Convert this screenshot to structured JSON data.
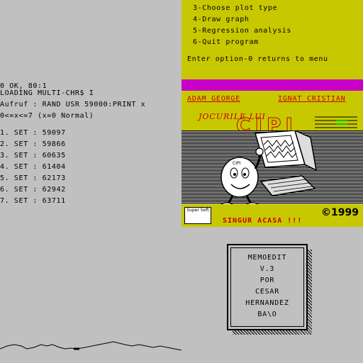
{
  "menu": {
    "items": [
      "3-Choose plot type",
      "4-Draw graph",
      "5-Regression analysis",
      "6-Quit program"
    ],
    "prompt": "Enter option-0 returns to menu"
  },
  "console": {
    "status": "0 OK, 80:1",
    "loading": "LOADING MULTI-CHR$ I",
    "call": "Aufruf : RAND USR 59000:PRINT x",
    "range": "0<=x<=7 (x=0 Normal)",
    "sets": [
      "1. SET : 59097",
      "2. SET : 59866",
      "3. SET : 60635",
      "4. SET : 61404",
      "5. SET : 62173",
      "6. SET : 62942",
      "7. SET : 63711"
    ]
  },
  "game": {
    "author1": "ADAM GEORGE",
    "author2": "IGNAT CRISTIAN",
    "subtitle": "JOCURILE LUI",
    "title": "CIPI",
    "character_label": "CIPI",
    "publisher": "Super Soft",
    "tagline": "SINGUR ACASA !!!",
    "year": "©1999"
  },
  "memo": {
    "lines": [
      "MEMOEDIT",
      "V.3",
      "POR",
      "CESAR",
      "HERNANDEZ",
      "BA\\O"
    ]
  },
  "colors": {
    "background": "#c0c0c0",
    "yellow": "#c8c800",
    "magenta": "#c800c8",
    "red": "#c80000"
  }
}
